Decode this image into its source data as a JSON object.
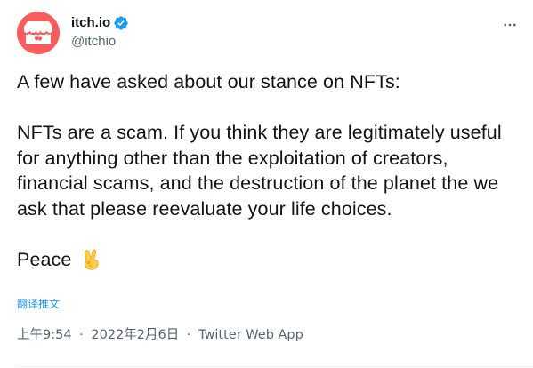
{
  "author": {
    "display_name": "itch.io",
    "handle": "@itchio",
    "verified": true,
    "avatar_color": "#fa5c5c",
    "avatar_icon": "itchio-logo-icon"
  },
  "tweet": {
    "line_1": "A few have asked about our stance on NFTs:",
    "line_2": "NFTs are a scam. If you think they are legitimately useful for anything other than the exploitation of creators, financial scams, and the destruction of the planet the we ask that please reevaluate your life choices.",
    "line_3": "Peace",
    "emoji": "victory-hand-icon"
  },
  "translate_label": "翻译推文",
  "meta": {
    "time": "上午9:54",
    "separator": "·",
    "date": "2022年2月6日",
    "source": "Twitter Web App"
  },
  "colors": {
    "link": "#1d9bf0",
    "secondary_text": "#536471",
    "primary_text": "#0f1419",
    "verified_badge": "#1d9bf0"
  }
}
